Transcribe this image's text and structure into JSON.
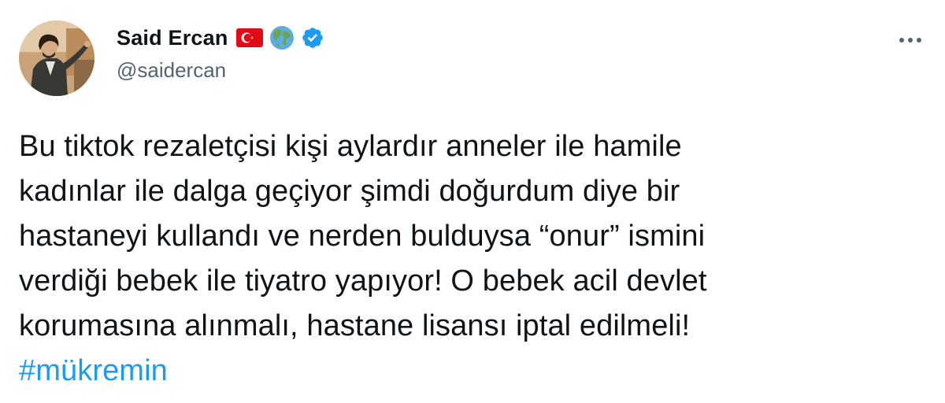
{
  "author": {
    "display_name": "Said Ercan",
    "handle": "@saidercan",
    "badges": [
      "turkey-flag-icon",
      "globe-icon",
      "verified-badge-icon"
    ]
  },
  "tweet": {
    "lines": [
      "Bu tiktok rezaletçisi kişi aylardır anneler ile hamile",
      "kadınlar ile dalga geçiyor şimdi doğurdum diye bir",
      "hastaneyi kullandı ve nerden bulduysa “onur” ismini",
      "verdiği bebek ile tiyatro yapıyor! O bebek acil devlet",
      "korumasına alınmalı, hastane lisansı iptal edilmeli!"
    ],
    "hashtag": "#mükremin"
  },
  "menu": {
    "icon": "more-options-icon"
  },
  "colors": {
    "link": "#1d9bf0",
    "text": "#0f1419",
    "secondary": "#536471",
    "verified": "#1d9bf0",
    "flag_red": "#e30a17"
  }
}
